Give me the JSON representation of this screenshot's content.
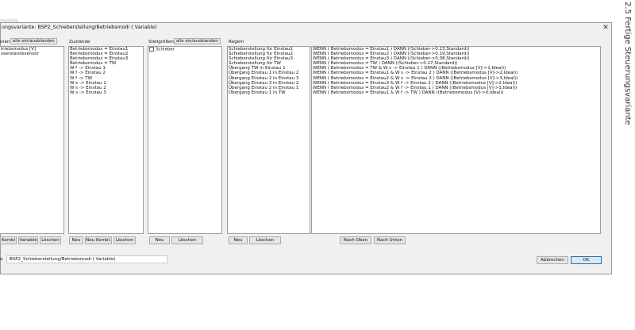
{
  "dialog": {
    "title": "ungsvariante: BSP2_Schieberstellung/Betriebsmodi ( Variable)",
    "close_glyph": "✕"
  },
  "sensors": {
    "header_label": "oren",
    "toggle_label": "alle ein/ausblenden",
    "items": [
      "triebsmodus [V]",
      "sserstandssensor"
    ]
  },
  "states": {
    "header_label": "Zustände",
    "items": [
      "Betriebsmodus = Einstau1",
      "Betriebsmodus = Einstau2",
      "Betriebsmodus = Einstau3",
      "Betriebsmodus = TW",
      "W f -> Einstau 1",
      "W f -> Einstau 2",
      "W f -> TW",
      "W s -> Einstau 1",
      "W s -> Einstau 2",
      "W s -> Einstau 3"
    ]
  },
  "actuators": {
    "header_label": "Stellgrößen",
    "toggle_label": "alle ein/ausblenden",
    "items": [
      "Schieber"
    ]
  },
  "rules": {
    "header_label": "Regeln",
    "names": [
      "Schieberstellung für Einstau1",
      "Schieberstellung für Einstau2",
      "Schieberstellung für Einstau3",
      "Schieberstellung für TW",
      "Übergang TW in Einstau 1",
      "Übergang Einstau 1 in Einstau 2",
      "Übergang Einstau 2 in Einstau 3",
      "Übergang Einstau 3 in Einstau 2",
      "Übergang Einstau 2 in Einstau 1",
      "Übergang Einstau 1 in TW"
    ],
    "definitions": [
      "WENN ( Betriebsmodus = Einstau1 ) DANN ((Schieber->0.23,Standard))",
      "WENN ( Betriebsmodus = Einstau2 ) DANN ((Schieber->0.19,Standard))",
      "WENN ( Betriebsmodus = Einstau3 ) DANN ((Schieber->0.08,Standard))",
      "WENN ( Betriebsmodus = TW ) DANN ((Schieber->0.27,Standard))",
      "WENN ( Betriebsmodus = TW & W s -> Einstau 1 ) DANN ((Betriebsmodus [V]->1,Ideal))",
      "WENN ( Betriebsmodus = Einstau1 & W s -> Einstau 2 ) DANN ((Betriebsmodus [V]->2,Ideal))",
      "WENN ( Betriebsmodus = Einstau2 & W s -> Einstau 3 ) DANN ((Betriebsmodus [V]->3,Ideal))",
      "WENN ( Betriebsmodus = Einstau3 & W f -> Einstau 2 ) DANN ((Betriebsmodus [V]->2,Ideal))",
      "WENN ( Betriebsmodus = Einstau2 & W f -> Einstau 1 ) DANN ((Betriebsmodus [V]->1,Ideal))",
      "WENN ( Betriebsmodus = Einstau1 & W f -> TW ) DANN ((Betriebsmodus [V]->0,Ideal))"
    ]
  },
  "buttons": {
    "kombi": "Kombi",
    "variable": "Variable",
    "sensors_delete": "Löschen",
    "states_new": "Neu",
    "states_new_combi": "Neu Kombi.",
    "states_delete": "Löschen",
    "actuators_new": "Neu",
    "actuators_delete": "Löschen",
    "rules_new": "Neu",
    "rules_delete": "Löschen",
    "move_up": "Nach Oben",
    "move_down": "Nach Unten",
    "cancel": "Abbrechen",
    "ok": "OK"
  },
  "footer": {
    "name_label": "e",
    "name_value": "BSP2_Schieberstellung/Betriebsmodi ( Variable)"
  },
  "sidebar": {
    "section_text": "2.5  Fertige Steuerungsvariante"
  }
}
